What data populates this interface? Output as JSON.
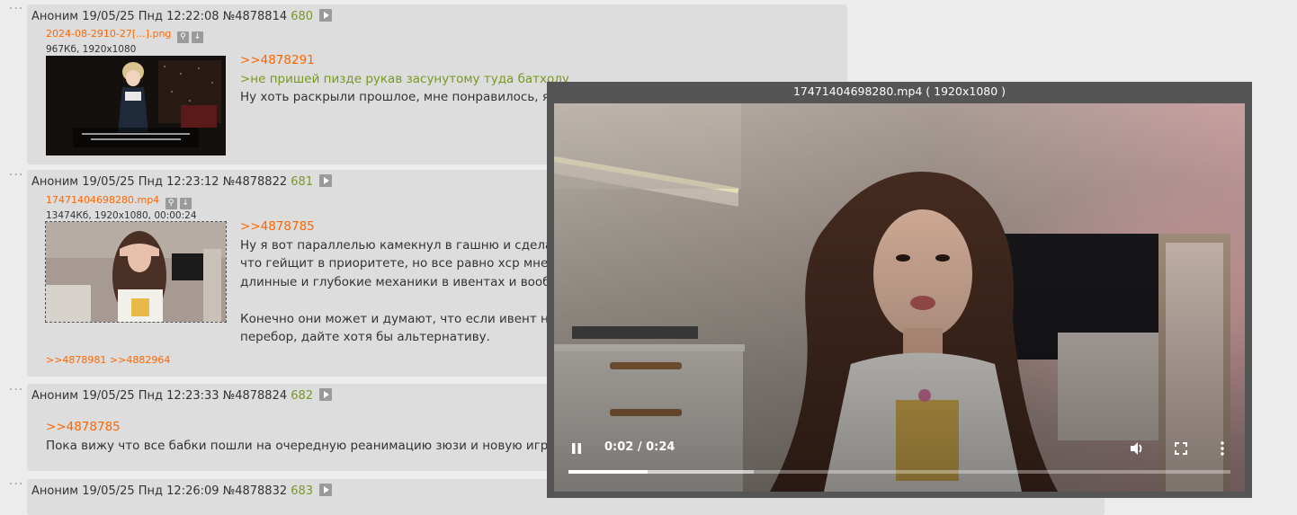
{
  "posts": [
    {
      "author": "Аноним",
      "date": "19/05/25 Пнд 12:22:08",
      "id": "№4878814",
      "num": "680",
      "file": {
        "name": "2024-08-2910-27[...].png",
        "info": "967Кб, 1920x1080"
      },
      "reply": ">>4878291",
      "quote": ">не пришей пизде рукав засунутому туда батхолу",
      "lines": [
        "Ну хоть раскрыли прошлое, мне понравилось, я"
      ]
    },
    {
      "author": "Аноним",
      "date": "19/05/25 Пнд 12:23:12",
      "id": "№4878822",
      "num": "681",
      "file": {
        "name": "17471404698280.mp4",
        "info": "13474Кб, 1920x1080, 00:00:24"
      },
      "reply": ">>4878785",
      "lines": [
        "Ну я вот параллелью камекнул в гашню и сделал",
        "что гейщит в приоритете, но все равно хср мне н",
        "длинные и глубокие механики в ивентах и вообщ",
        "",
        "Конечно они может и думают, что если ивент не",
        "перебор, дайте хотя бы альтернативу."
      ],
      "backlinks": ">>4878981 >>4882964"
    },
    {
      "author": "Аноним",
      "date": "19/05/25 Пнд 12:23:33",
      "id": "№4878824",
      "num": "682",
      "reply": ">>4878785",
      "lines": [
        "Пока вижу что все бабки пошли на очередную реанимацию зюзи и новую игру п"
      ]
    },
    {
      "author": "Аноним",
      "date": "19/05/25 Пнд 12:26:09",
      "id": "№4878832",
      "num": "683"
    }
  ],
  "viewer": {
    "title": "17471404698280.mp4 ( 1920x1080 )",
    "time": "0:02 / 0:24",
    "progress_fraction": 0.12,
    "buffered_fraction": 0.28
  },
  "icons": {
    "more": "more-dots-icon",
    "play": "play-icon",
    "search": "search-icon",
    "download": "download-icon",
    "pause": "pause-icon",
    "volume": "volume-icon",
    "fullscreen": "fullscreen-icon",
    "menu": "kebab-menu-icon"
  },
  "colors": {
    "background": "#ececec",
    "post_bg": "#dddddd",
    "link": "#ff6600",
    "quote": "#789922",
    "viewer_bg": "#555555"
  }
}
